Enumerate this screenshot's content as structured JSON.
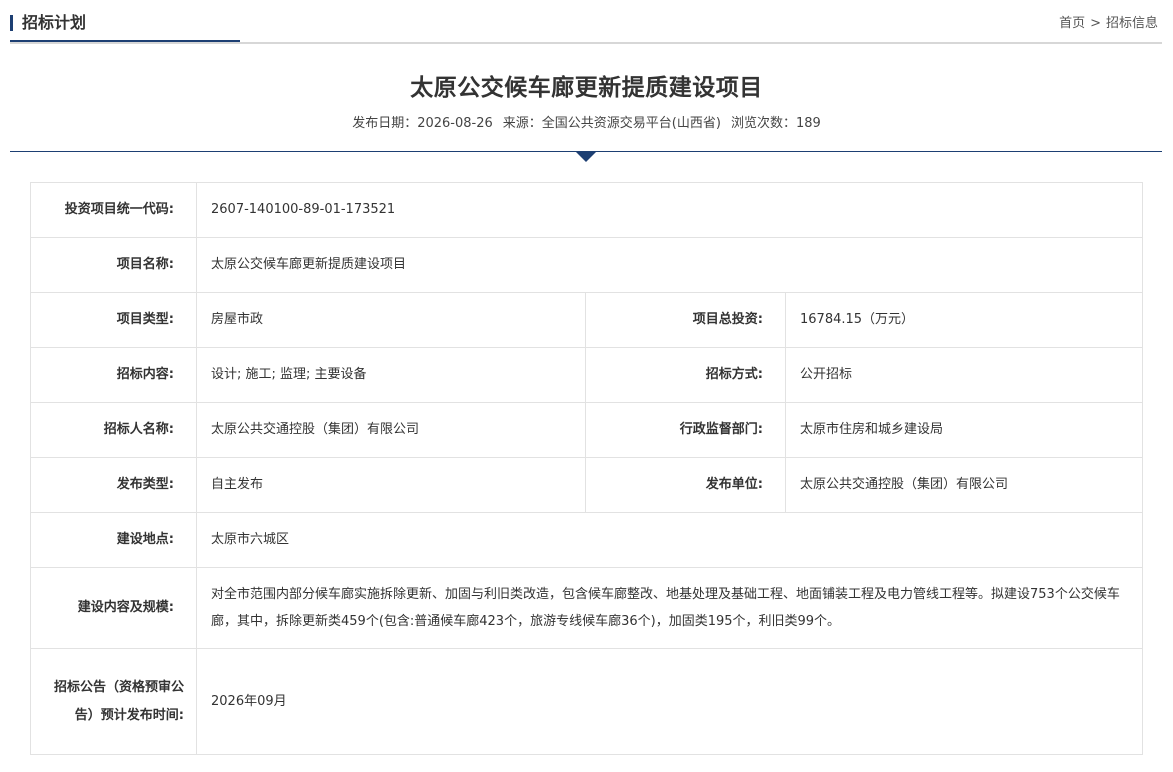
{
  "header": {
    "section_title": "招标计划",
    "breadcrumb": {
      "home": "首页",
      "separator": ">",
      "current": "招标信息"
    }
  },
  "title": "太原公交候车廊更新提质建设项目",
  "meta": {
    "publish_date_label": "发布日期：",
    "publish_date": "2026-08-26",
    "source_label": "来源：",
    "source": "全国公共资源交易平台(山西省)",
    "views_label": "浏览次数：",
    "views": "189"
  },
  "details": {
    "code_label": "投资项目统一代码:",
    "code": "2607-140100-89-01-173521",
    "name_label": "项目名称:",
    "name": "太原公交候车廊更新提质建设项目",
    "type_label": "项目类型:",
    "type": "房屋市政",
    "total_investment_label": "项目总投资:",
    "total_investment": "16784.15（万元）",
    "tender_content_label": "招标内容:",
    "tender_content": "设计; 施工; 监理; 主要设备",
    "tender_method_label": "招标方式:",
    "tender_method": "公开招标",
    "tenderer_label": "招标人名称:",
    "tenderer": "太原公共交通控股（集团）有限公司",
    "supervisor_label": "行政监督部门:",
    "supervisor": "太原市住房和城乡建设局",
    "publish_type_label": "发布类型:",
    "publish_type": "自主发布",
    "publisher_label": "发布单位:",
    "publisher": "太原公共交通控股（集团）有限公司",
    "location_label": "建设地点:",
    "location": "太原市六城区",
    "scope_label": "建设内容及规模:",
    "scope": "对全市范围内部分候车廊实施拆除更新、加固与利旧类改造，包含候车廊整改、地基处理及基础工程、地面铺装工程及电力管线工程等。拟建设753个公交候车廊，其中，拆除更新类459个(包含:普通候车廊423个，旅游专线候车廊36个)，加固类195个，利旧类99个。",
    "notice_time_label": "招标公告（资格预审公告）预计发布时间:",
    "notice_time": "2026年09月"
  }
}
